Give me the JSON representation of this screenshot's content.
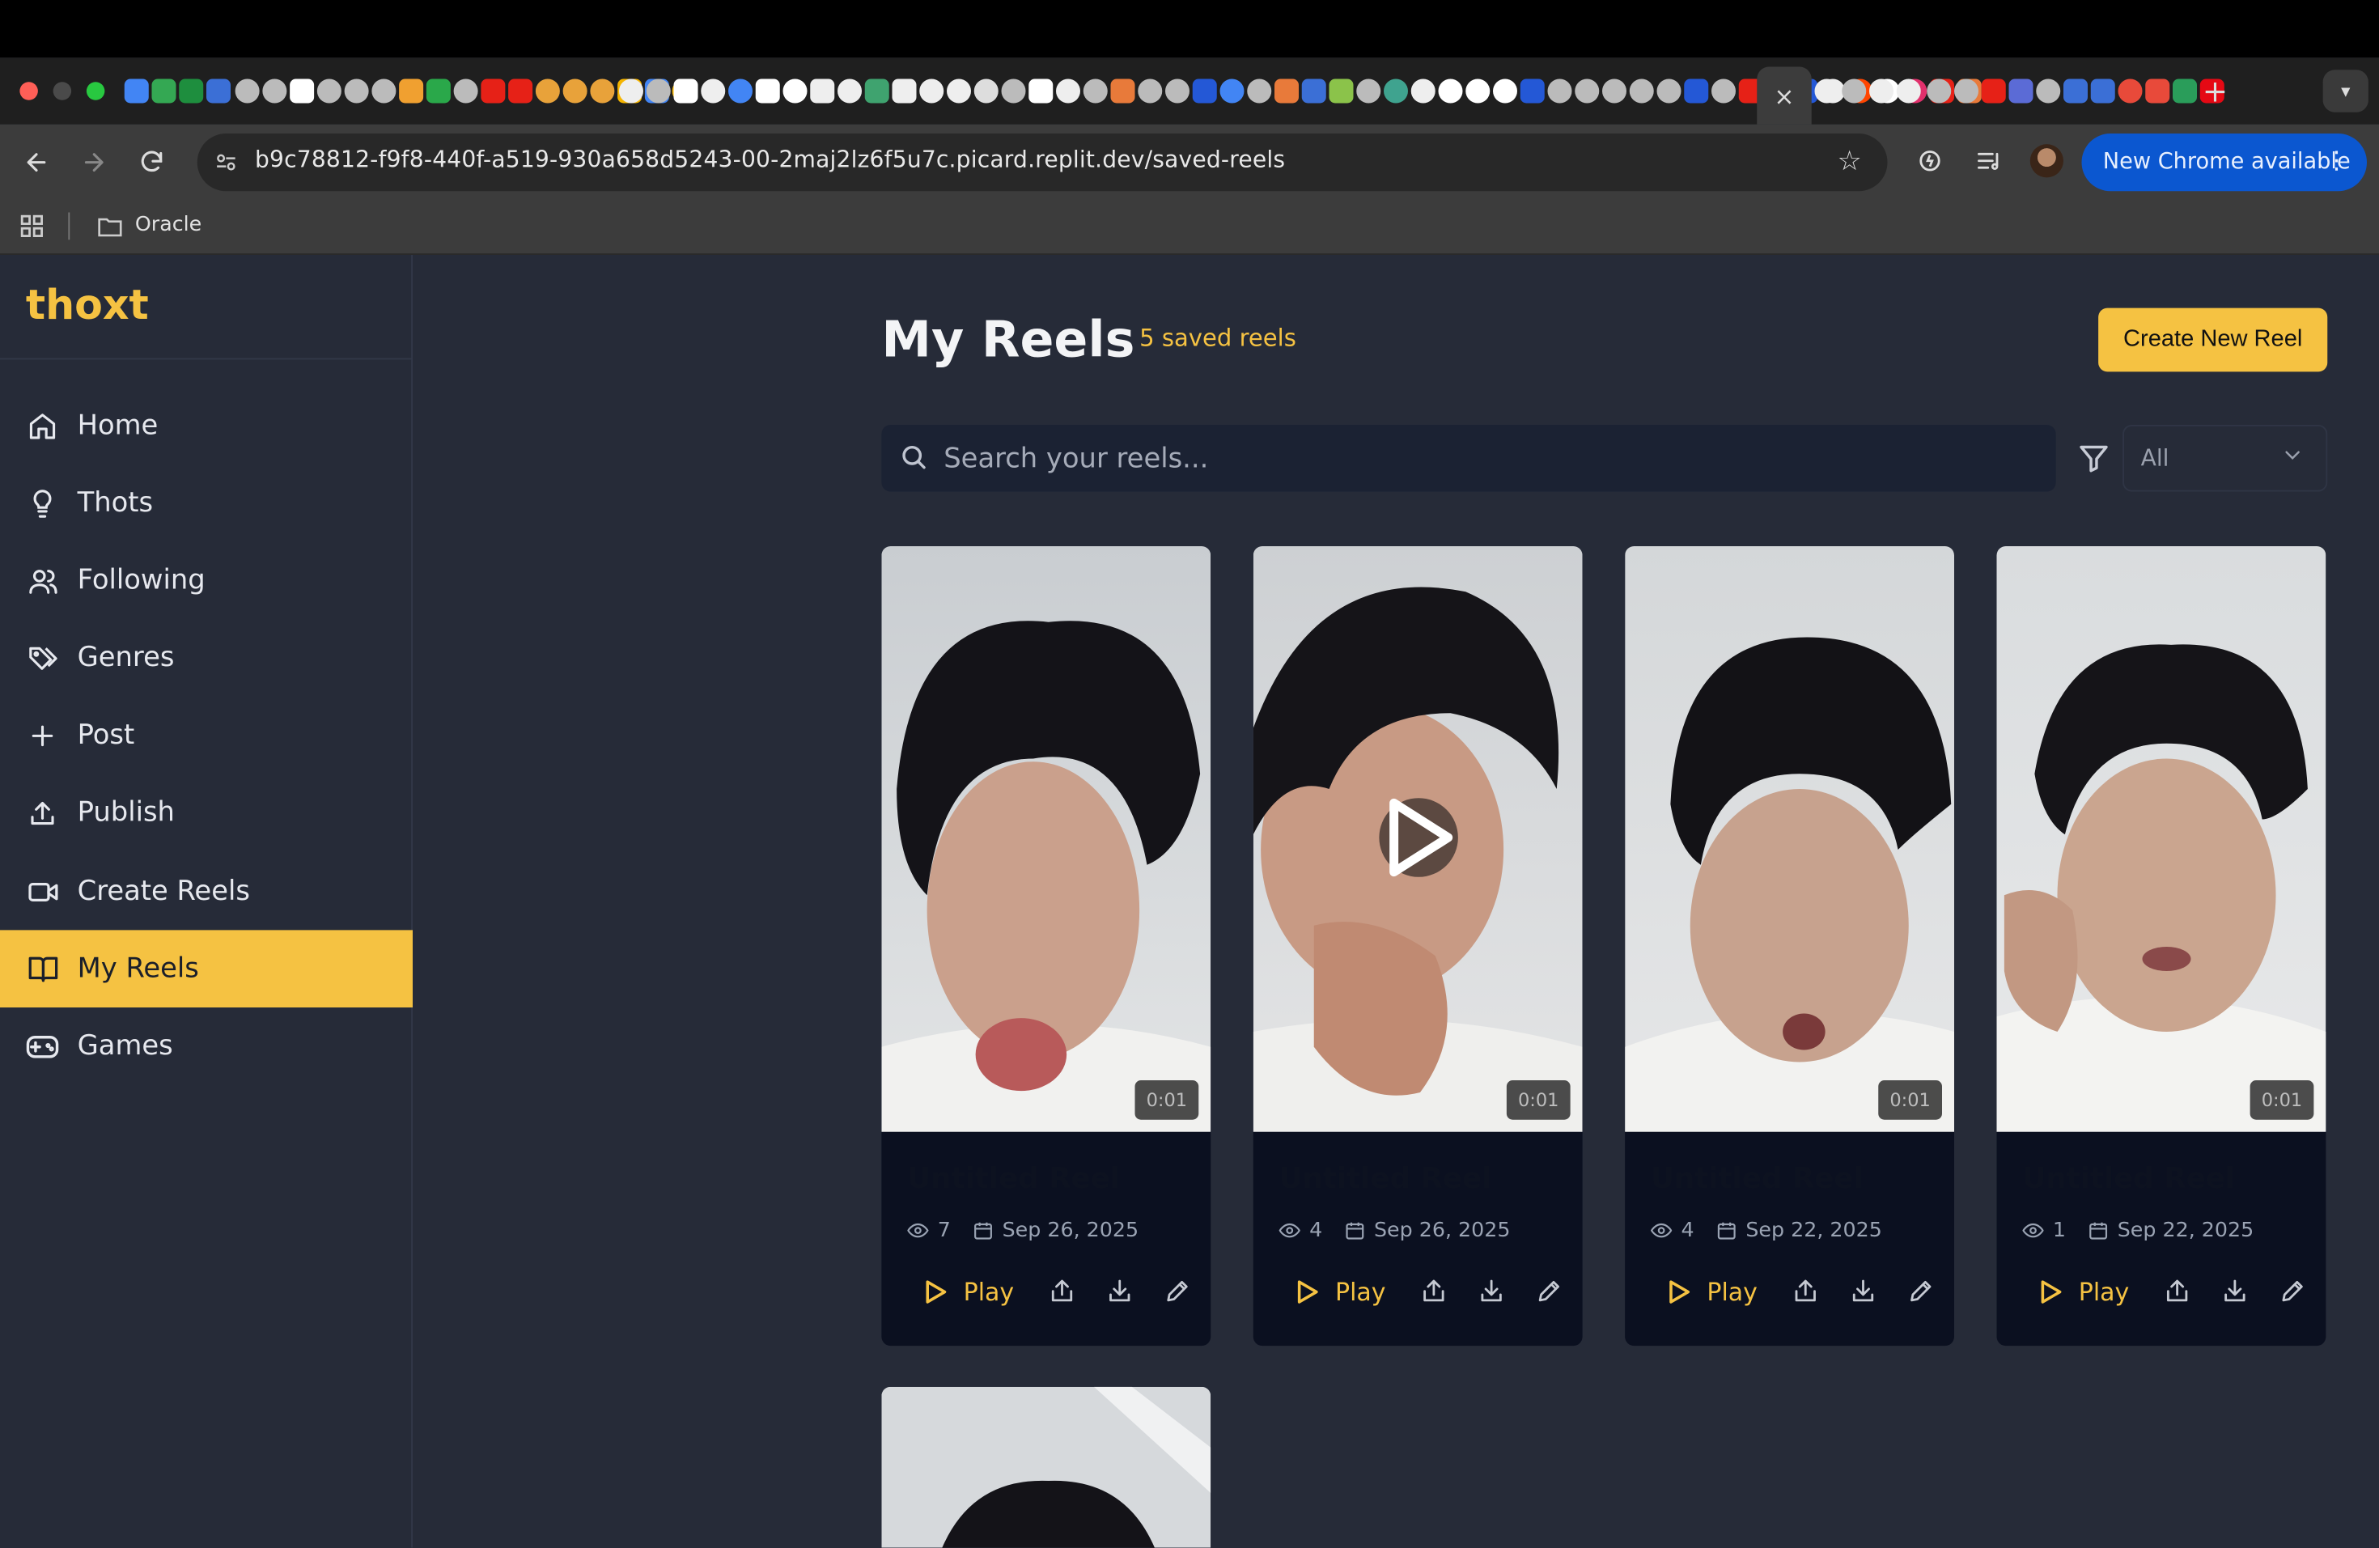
{
  "browser": {
    "url": "b9c78812-f9f8-440f-a519-930a658d5243-00-2maj2lz6f5u7c.picard.replit.dev/saved-reels",
    "update_label": "New Chrome available",
    "bookmark_folder": "Oracle",
    "active_tab_close": "×",
    "new_tab": "+"
  },
  "app": {
    "brand": "thoxt",
    "accent_color": "#f5c242"
  },
  "sidebar": {
    "items": [
      {
        "label": "Home",
        "icon": "home-icon"
      },
      {
        "label": "Thots",
        "icon": "lightbulb-icon"
      },
      {
        "label": "Following",
        "icon": "users-icon"
      },
      {
        "label": "Genres",
        "icon": "tags-icon"
      },
      {
        "label": "Post",
        "icon": "plus-icon"
      },
      {
        "label": "Publish",
        "icon": "upload-icon"
      },
      {
        "label": "Create Reels",
        "icon": "video-icon"
      },
      {
        "label": "My Reels",
        "icon": "book-open-icon",
        "active": true
      },
      {
        "label": "Games",
        "icon": "gamepad-icon"
      }
    ]
  },
  "header": {
    "title": "My Reels",
    "count": "5 saved reels",
    "create_label": "Create New Reel"
  },
  "search": {
    "placeholder": "Search your reels...",
    "filter_value": "All"
  },
  "reels": [
    {
      "title": "Untitled Reel",
      "duration": "0:01",
      "views": "7",
      "date": "Sep 26, 2025",
      "play_label": "Play"
    },
    {
      "title": "Untitled Reel",
      "duration": "0:01",
      "views": "4",
      "date": "Sep 26, 2025",
      "play_label": "Play"
    },
    {
      "title": "Untitled Reel",
      "duration": "0:01",
      "views": "4",
      "date": "Sep 22, 2025",
      "play_label": "Play"
    },
    {
      "title": "Untitled Reel",
      "duration": "0:01",
      "views": "1",
      "date": "Sep 22, 2025",
      "play_label": "Play"
    }
  ]
}
